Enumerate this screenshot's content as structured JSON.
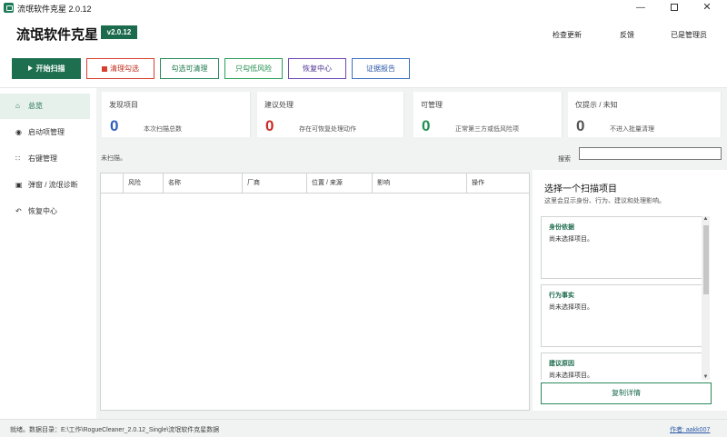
{
  "window": {
    "title": "流氓软件克星 2.0.12",
    "controls": {
      "minimize": "—",
      "close": "✕"
    }
  },
  "header": {
    "app_name": "流氓软件克星",
    "version": "v2.0.12",
    "links": {
      "check_update": "检查更新",
      "feedback": "反馈",
      "admin_status": "已是管理员"
    }
  },
  "toolbar": {
    "start_scan": "开始扫描",
    "clear_checked": "清理勾选",
    "check_cleanable": "勾选可清理",
    "check_low_risk": "只勾低风险",
    "recovery_center": "恢复中心",
    "evidence_report": "证据报告"
  },
  "sidebar": {
    "items": [
      {
        "icon": "⌂",
        "label": "总览"
      },
      {
        "icon": "◉",
        "label": "启动项管理"
      },
      {
        "icon": "∷",
        "label": "右键管理"
      },
      {
        "icon": "▣",
        "label": "弹窗 / 流氓诊断"
      },
      {
        "icon": "↶",
        "label": "恢复中心"
      }
    ]
  },
  "stats": [
    {
      "label": "发现项目",
      "value": "0",
      "desc": "本次扫描总数",
      "color": "#2d5fc0"
    },
    {
      "label": "建议处理",
      "value": "0",
      "desc": "存在可恢复处理动作",
      "color": "#cc2a26"
    },
    {
      "label": "可管理",
      "value": "0",
      "desc": "正常第三方或低风险项",
      "color": "#1f9152"
    },
    {
      "label": "仅提示 / 未知",
      "value": "0",
      "desc": "不进入批量清理",
      "color": "#555555"
    }
  ],
  "scan": {
    "status": "未扫描。"
  },
  "search": {
    "label": "搜索",
    "value": ""
  },
  "table": {
    "columns": [
      "",
      "风险",
      "名称",
      "厂商",
      "位置 / 来源",
      "影响",
      "操作"
    ],
    "rows": []
  },
  "detail": {
    "title": "选择一个扫描项目",
    "subtitle": "这里会显示身份、行为、建议和处理影响。",
    "cards": [
      {
        "title": "身份依据",
        "body": "尚未选择项目。"
      },
      {
        "title": "行为事实",
        "body": "尚未选择项目。"
      },
      {
        "title": "建议原因",
        "body": "尚未选择项目。"
      }
    ],
    "copy_button": "复制详情"
  },
  "statusbar": {
    "text": "就绪。数据目录：E:\\工作\\RogueCleaner_2.0.12_Single\\流氓软件克星数据",
    "author": "作者: aakk007"
  }
}
